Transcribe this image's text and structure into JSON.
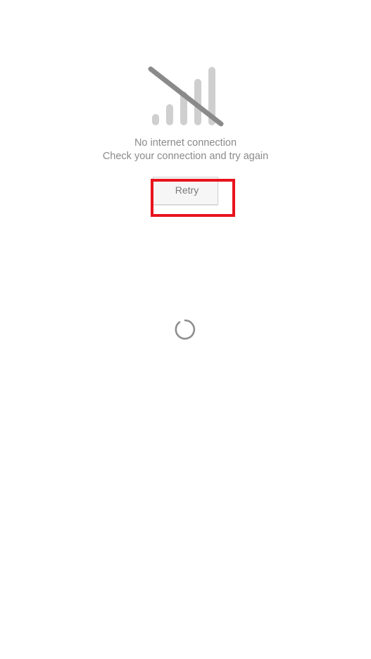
{
  "status": {
    "title": "No internet connection",
    "subtitle": "Check your connection and try again"
  },
  "actions": {
    "retry_label": "Retry"
  },
  "icons": {
    "status_icon": "no-signal-icon",
    "loading_icon": "loading-spinner-icon"
  },
  "colors": {
    "text": "#8a8a8a",
    "icon_bars": "#cfcfcf",
    "icon_slash": "#8a8a8a",
    "highlight": "#e8131c",
    "spinner": "#8e8e8e"
  }
}
